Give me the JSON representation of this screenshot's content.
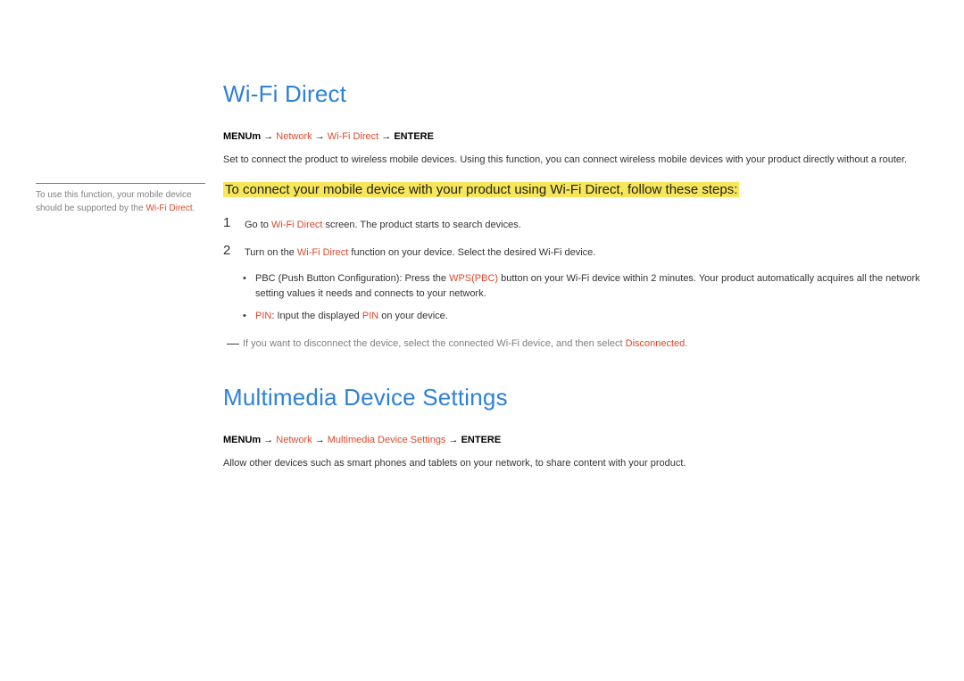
{
  "sidebar": {
    "note_pre": "To use this function, your mobile device should be supported by the ",
    "note_em": "Wi-Fi Direct",
    "note_post": "."
  },
  "section1": {
    "title": "Wi-Fi Direct",
    "menu_prefix": "MENU",
    "menu_m": "m",
    "menu_arrow": " → ",
    "menu_network": "Network",
    "menu_item": "Wi-Fi Direct",
    "menu_enter": "ENTER",
    "menu_e": "E",
    "desc": "Set to connect the product to wireless mobile devices. Using this function, you can connect wireless mobile devices with your product directly without a router.",
    "highlight": "To connect your mobile device with your product using Wi-Fi Direct, follow these steps:",
    "step1_num": "1",
    "step1_pre": "Go to ",
    "step1_em": "Wi-Fi Direct",
    "step1_post": " screen. The product starts to search devices.",
    "step2_num": "2",
    "step2_pre": "Turn on the ",
    "step2_em": "Wi-Fi Direct",
    "step2_post": " function on your device. Select the desired Wi-Fi device.",
    "bullet1_pre": "PBC (Push Button Configuration): Press the ",
    "bullet1_em": "WPS(PBC)",
    "bullet1_post": " button on your Wi-Fi device within 2 minutes. Your product automatically acquires all the network setting values it needs and connects to your network.",
    "bullet2_em1": "PIN",
    "bullet2_mid": ": Input the displayed ",
    "bullet2_em2": "PIN",
    "bullet2_post": " on your device.",
    "note_dash": "―",
    "note_pre": "If you want to disconnect the device, select the connected Wi-Fi device, and then select ",
    "note_em": "Disconnected",
    "note_post": "."
  },
  "section2": {
    "title": "Multimedia Device Settings",
    "menu_prefix": "MENU",
    "menu_m": "m",
    "menu_arrow": " → ",
    "menu_network": "Network",
    "menu_item": "Multimedia Device Settings",
    "menu_enter": "ENTER",
    "menu_e": "E",
    "desc": "Allow other devices such as smart phones and tablets on your network, to share content with your product."
  }
}
